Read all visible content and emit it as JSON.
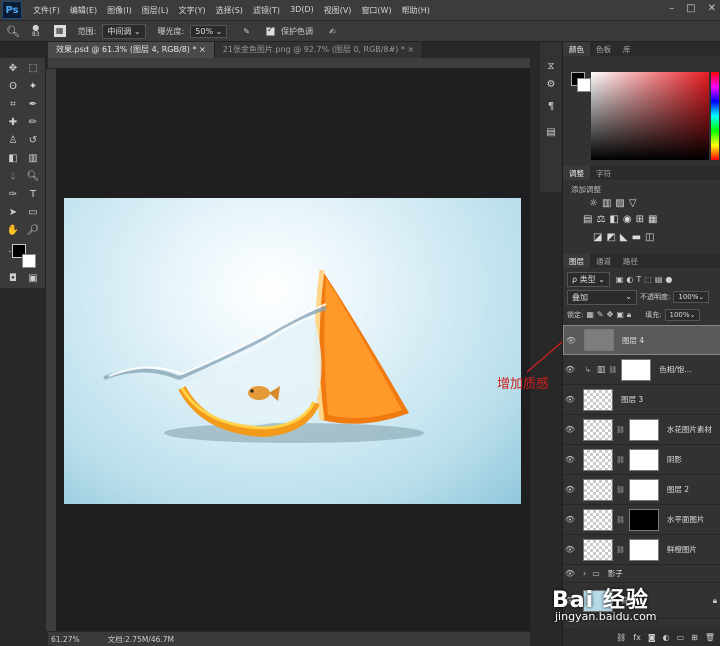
{
  "app": {
    "logo": "Ps"
  },
  "menubar": {
    "items": [
      "文件(F)",
      "编辑(E)",
      "图像(I)",
      "图层(L)",
      "文字(Y)",
      "选择(S)",
      "滤镜(T)",
      "3D(D)",
      "视图(V)",
      "窗口(W)",
      "帮助(H)"
    ]
  },
  "options": {
    "brush_size": "83",
    "range_label": "范围:",
    "range_value": "中间调",
    "exposure_label": "曝光度:",
    "exposure_value": "50%",
    "protect_label": "保护色调"
  },
  "tabs": [
    {
      "label": "效果.psd @ 61.3% (图层 4, RGB/8) *",
      "close": "×"
    },
    {
      "label": "21张金鱼图片.png @ 92.7% (图层 0, RGB/8#) *",
      "close": "×"
    }
  ],
  "status": {
    "zoom": "61.27%",
    "doc": "文档:2.75M/46.7M"
  },
  "color_panel": {
    "tabs": [
      "颜色",
      "色板",
      "库"
    ]
  },
  "adjust_panel": {
    "tabs": [
      "调整",
      "字符"
    ],
    "title": "添加调整"
  },
  "layers_panel": {
    "tabs": [
      "图层",
      "通道",
      "路径"
    ],
    "filter_label": "类型",
    "blend_mode": "叠加",
    "opacity_label": "不透明度:",
    "opacity_value": "100%",
    "lock_label": "锁定:",
    "fill_label": "填充:",
    "fill_value": "100%",
    "layers": [
      {
        "name": "图层 4",
        "selected": true
      },
      {
        "name": "色相/饱...",
        "adjust": true
      },
      {
        "name": "图层 3"
      },
      {
        "name": "水花图片素材"
      },
      {
        "name": "阴影"
      },
      {
        "name": "图层 2"
      },
      {
        "name": "水平面图片"
      },
      {
        "name": "鲜橙图片"
      },
      {
        "name": "影子",
        "group": true
      },
      {
        "name": "背景"
      }
    ]
  },
  "annotation": "增加质感",
  "watermark": {
    "logo": "Bai 经验",
    "url": "jingyan.baidu.com"
  },
  "colors": {
    "accent": "#d02020",
    "selected_layer": "#5a5a5a"
  }
}
